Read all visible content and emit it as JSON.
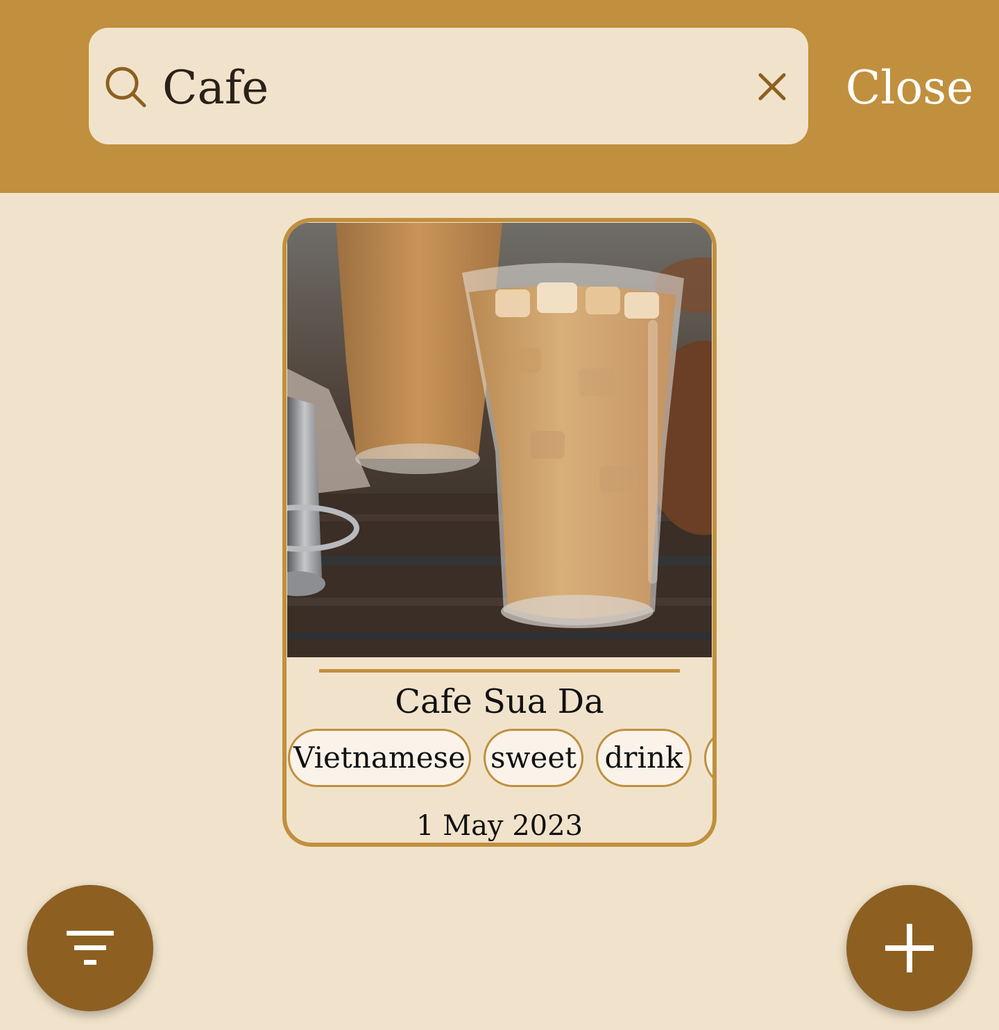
{
  "header": {
    "search_value": "Cafe",
    "close_label": "Close",
    "search_icon": "search-icon",
    "clear_icon": "close-icon"
  },
  "results": [
    {
      "title": "Cafe Sua Da",
      "tags": [
        "Vietnamese",
        "sweet",
        "drink",
        ""
      ],
      "date": "1 May 2023",
      "image": "iced-coffee-photo"
    }
  ],
  "fabs": {
    "filter_icon": "filter-icon",
    "add_icon": "plus-icon"
  },
  "colors": {
    "header_bg": "#c0903e",
    "page_bg": "#f1e3cb",
    "fab_bg": "#8d6021",
    "accent": "#c0903e"
  }
}
